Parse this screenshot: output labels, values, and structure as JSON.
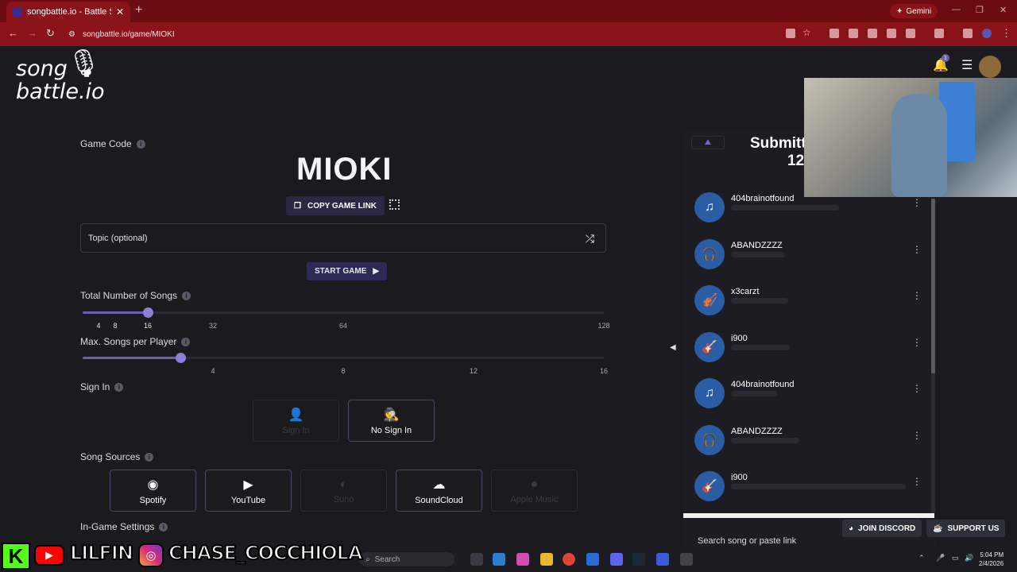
{
  "browser": {
    "tab_title": "songbattle.io - Battle Songs ag",
    "url": "songbattle.io/game/MIOKI",
    "gemini_label": "Gemini"
  },
  "logo": {
    "line1": "song",
    "line2": "battle.io"
  },
  "game": {
    "code_label": "Game Code",
    "code": "MIOKI",
    "copy_label": "COPY GAME LINK",
    "topic_placeholder": "Topic (optional)",
    "start_label": "START GAME"
  },
  "songs_slider": {
    "label": "Total Number of Songs",
    "value": 16,
    "ticks": [
      "4",
      "8",
      "16",
      "32",
      "64",
      "128"
    ]
  },
  "per_player_slider": {
    "label": "Max. Songs per Player",
    "value": 2,
    "ticks": [
      "4",
      "8",
      "12",
      "16"
    ]
  },
  "signin": {
    "label": "Sign In",
    "options": [
      {
        "label": "Sign In",
        "enabled": false,
        "icon": "person-icon"
      },
      {
        "label": "No Sign In",
        "enabled": true,
        "icon": "incognito-icon"
      }
    ]
  },
  "sources": {
    "label": "Song Sources",
    "options": [
      {
        "label": "Spotify",
        "enabled": true,
        "icon": "spotify-icon"
      },
      {
        "label": "YouTube",
        "enabled": true,
        "icon": "youtube-icon"
      },
      {
        "label": "Suno",
        "enabled": false,
        "icon": "suno-icon"
      },
      {
        "label": "SoundCloud",
        "enabled": true,
        "icon": "soundcloud-icon"
      },
      {
        "label": "Apple Music",
        "enabled": false,
        "icon": "apple-icon"
      }
    ]
  },
  "ingame_label": "In-Game Settings",
  "panel": {
    "title": "Submitt",
    "count": "12",
    "players": [
      {
        "name": "404brainotfound",
        "icon": "band-icon"
      },
      {
        "name": "ABANDZZZZ",
        "icon": "headphones-icon"
      },
      {
        "name": "x3carzt",
        "icon": "violin-icon"
      },
      {
        "name": "i900",
        "icon": "guitar-icon"
      },
      {
        "name": "404brainotfound",
        "icon": "band-icon"
      },
      {
        "name": "ABANDZZZZ",
        "icon": "headphones-icon"
      },
      {
        "name": "i900",
        "icon": "guitar-icon"
      }
    ],
    "search_placeholder": "Search song or paste link"
  },
  "footer_buttons": {
    "discord": "JOIN DISCORD",
    "support": "SUPPORT US"
  },
  "notifications": {
    "count": "1"
  },
  "stream": {
    "kick": "K",
    "handle1": "LILFIN",
    "handle2": "CHASE_COCCHIOLA"
  },
  "taskbar": {
    "search": "Search",
    "time": "5:04 PM",
    "date": "2/4/2026"
  }
}
